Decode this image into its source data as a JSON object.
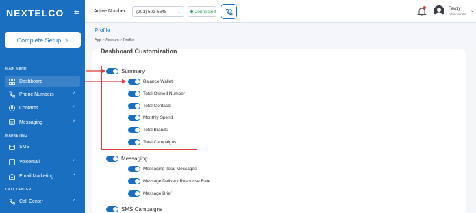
{
  "sidebar": {
    "logo": "NEXTELCO",
    "setup_label": "Complete Setup",
    "setup_chevron": ">",
    "sections": [
      "MAIN MENU",
      "MARKETING",
      "CALL CENTER"
    ],
    "items": [
      {
        "label": "Dashboard",
        "icon": "grid-icon",
        "chevron": false
      },
      {
        "label": "Phone Numbers",
        "icon": "phone-icon",
        "chevron": true
      },
      {
        "label": "Contacts",
        "icon": "contacts-icon",
        "chevron": true
      },
      {
        "label": "Messaging",
        "icon": "message-icon",
        "chevron": true
      },
      {
        "label": "SMS",
        "icon": "sms-icon",
        "chevron": false
      },
      {
        "label": "Voicemail",
        "icon": "voicemail-icon",
        "chevron": true
      },
      {
        "label": "Email Marketing",
        "icon": "email-icon",
        "chevron": true
      },
      {
        "label": "Call Center",
        "icon": "phone-icon",
        "chevron": true
      }
    ]
  },
  "topbar": {
    "active_label": "Active Number :",
    "number": "(201) 502-5648",
    "status": "Connected",
    "user_name": "Fawzy",
    "user_role": "Administrator"
  },
  "page": {
    "title": "Profile",
    "breadcrumb": "App > Account > Profile",
    "card_title": "Dashboard Customization"
  },
  "groups": {
    "summary": {
      "label": "Summary",
      "items": [
        "Balance Wallet",
        "Total Owned Number",
        "Total Contacts",
        "Monthly Spend",
        "Total Brands",
        "Total Campaigns"
      ]
    },
    "messaging": {
      "label": "Messaging",
      "items": [
        "Messaging Total Messages",
        "Message Delivery Response Rate",
        "Message Brief"
      ]
    },
    "sms": {
      "label": "SMS Campaigns"
    }
  },
  "colors": {
    "accent": "#1a6fc0",
    "highlight": "#e23b3b",
    "connected": "#2aa05a"
  }
}
